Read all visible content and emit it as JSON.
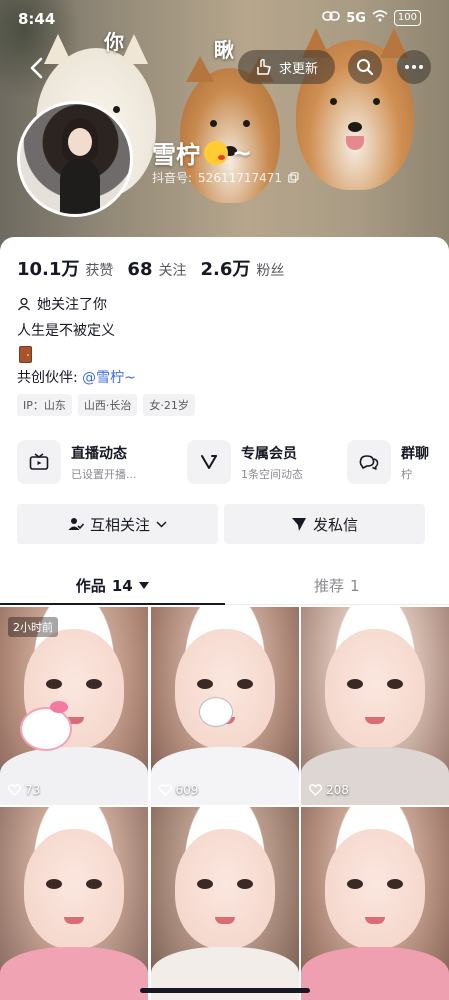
{
  "status_bar": {
    "time": "8:44",
    "network": "5G",
    "battery": "100"
  },
  "banner": {
    "overlay_text_1": "你",
    "overlay_text_2": "瞅",
    "update_button_label": "求更新"
  },
  "profile": {
    "nickname": "雪柠",
    "nickname_suffix": "~",
    "douyin_id_label": "抖音号:",
    "douyin_id": "52611717471"
  },
  "stats": [
    {
      "value": "10.1万",
      "label": "获赞"
    },
    {
      "value": "68",
      "label": "关注"
    },
    {
      "value": "2.6万",
      "label": "粉丝"
    }
  ],
  "relation": "她关注了你",
  "bio": "人生是不被定义",
  "partner": {
    "label": "共创伙伴:",
    "mention": "@雪柠~"
  },
  "tags": [
    "IP：山东",
    "山西·长治",
    "女·21岁"
  ],
  "entries": [
    {
      "title": "直播动态",
      "subtitle": "已设置开播..."
    },
    {
      "title": "专属会员",
      "subtitle": "1条空间动态"
    },
    {
      "title": "群聊",
      "subtitle": "柠"
    }
  ],
  "actions": {
    "follow": "互相关注",
    "message": "发私信"
  },
  "tabs": [
    {
      "label": "作品",
      "count": "14"
    },
    {
      "label": "推荐",
      "count": "1"
    }
  ],
  "videos": [
    {
      "likes": "73",
      "badge": "2小时前",
      "shirt": "#f1f1f3"
    },
    {
      "likes": "609",
      "badge": "",
      "shirt": "#f4f4f6"
    },
    {
      "likes": "208",
      "badge": "",
      "shirt": "#ddd6d2"
    },
    {
      "likes": "",
      "badge": "",
      "shirt": "#f0a4b3"
    },
    {
      "likes": "",
      "badge": "",
      "shirt": "#f3ede9"
    },
    {
      "likes": "",
      "badge": "",
      "shirt": "#ee9fb0"
    }
  ],
  "colors": {
    "accent_link": "#3f6de0",
    "text_primary": "#161823",
    "text_secondary": "#57585f"
  }
}
